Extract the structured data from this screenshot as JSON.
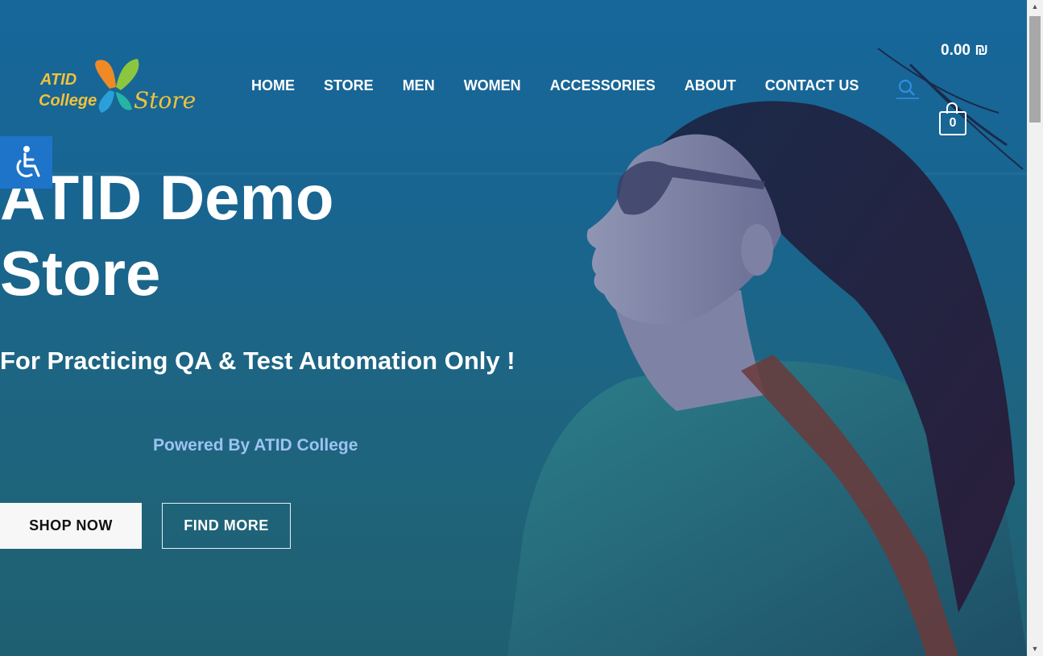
{
  "logo": {
    "line1": "ATID",
    "line2": "College",
    "line3": "Store"
  },
  "nav": {
    "items": [
      {
        "label": "HOME"
      },
      {
        "label": "STORE"
      },
      {
        "label": "MEN"
      },
      {
        "label": "WOMEN"
      },
      {
        "label": "ACCESSORIES"
      },
      {
        "label": "ABOUT"
      },
      {
        "label": "CONTACT US"
      }
    ]
  },
  "cart": {
    "total": "0.00 ₪",
    "count": "0"
  },
  "hero": {
    "title_line1": "ATID Demo",
    "title_line2": "Store",
    "subtitle": "For Practicing QA & Test Automation Only !",
    "powered": "Powered By ATID College",
    "shop_now": "SHOP NOW",
    "find_more": "FIND MORE"
  },
  "icons": {
    "search": "search-icon",
    "cart": "shopping-bag-icon",
    "accessibility": "wheelchair-icon"
  },
  "colors": {
    "background": "#17679b",
    "accent_blue": "#1e74c8",
    "logo_yellow": "#f0c23a",
    "powered_text": "#9cc3f2"
  }
}
